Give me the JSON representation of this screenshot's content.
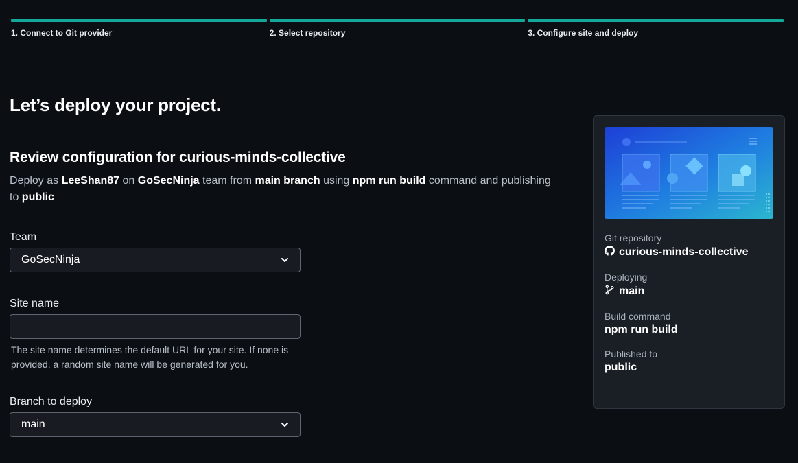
{
  "steps": [
    {
      "label": "1. Connect to Git provider"
    },
    {
      "label": "2. Select repository"
    },
    {
      "label": "3. Configure site and deploy"
    }
  ],
  "page": {
    "title": "Let’s deploy your project.",
    "review_heading": "Review configuration for curious-minds-collective",
    "summary": {
      "t1": "Deploy as ",
      "user": "LeeShan87",
      "t2": " on ",
      "team": "GoSecNinja",
      "t3": " team from ",
      "branch": "main branch",
      "t4": " using ",
      "command": "npm run build",
      "t5": " command and publishing to ",
      "publish": "public"
    }
  },
  "form": {
    "team": {
      "label": "Team",
      "value": "GoSecNinja"
    },
    "site_name": {
      "label": "Site name",
      "value": "",
      "help": "The site name determines the default URL for your site. If none is provided, a random site name will be generated for you."
    },
    "branch": {
      "label": "Branch to deploy",
      "value": "main"
    }
  },
  "sidebar": {
    "repo": {
      "label": "Git repository",
      "value": "curious-minds-collective",
      "icon": "github-icon"
    },
    "deploying": {
      "label": "Deploying",
      "value": "main",
      "icon": "git-branch-icon"
    },
    "build": {
      "label": "Build command",
      "value": "npm run build"
    },
    "published": {
      "label": "Published to",
      "value": "public"
    }
  },
  "colors": {
    "background": "#0b0e12",
    "accent": "#14a89a",
    "panel": "#1a1f26"
  }
}
